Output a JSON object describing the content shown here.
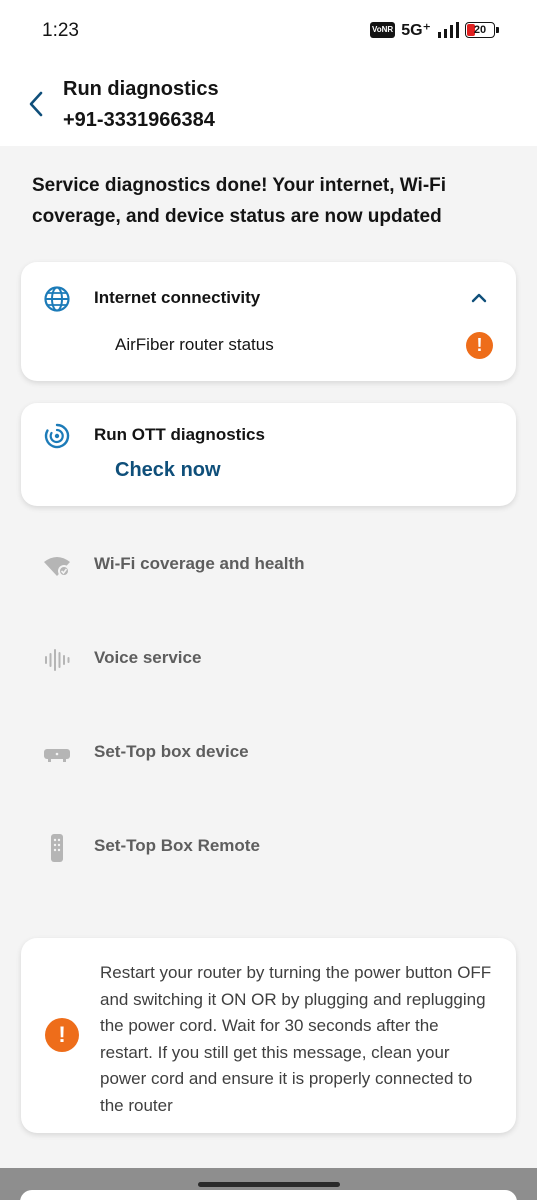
{
  "status_bar": {
    "time": "1:23",
    "vonr": "VoNR",
    "network": "5G⁺",
    "battery": "20"
  },
  "header": {
    "title": "Run diagnostics",
    "phone": "+91-3331966384"
  },
  "message": "Service diagnostics done! Your internet, Wi-Fi coverage, and device status are now updated",
  "internet_card": {
    "title": "Internet connectivity",
    "icon": "globe-icon",
    "item_label": "AirFiber router status",
    "item_status_icon": "warning-icon"
  },
  "ott_card": {
    "title": "Run OTT diagnostics",
    "icon": "ott-diagnostics-icon",
    "action": "Check now"
  },
  "services": [
    {
      "label": "Wi-Fi coverage and health",
      "icon": "wifi-icon"
    },
    {
      "label": "Voice service",
      "icon": "voice-wave-icon"
    },
    {
      "label": "Set-Top box device",
      "icon": "set-top-box-icon"
    },
    {
      "label": "Set-Top Box Remote",
      "icon": "remote-icon"
    }
  ],
  "advice": {
    "text": "Restart your router by turning the power button OFF and switching it ON  OR by plugging and replugging the power cord. Wait for 30 seconds after the restart. If you still get this message, clean your power cord and ensure it is properly connected to the router",
    "icon": "warning-icon"
  },
  "colors": {
    "accent_blue": "#0f4f7a",
    "icon_blue": "#1c7bb8",
    "warning_orange": "#ee6d1a",
    "muted_gray": "#5e5e5e"
  }
}
